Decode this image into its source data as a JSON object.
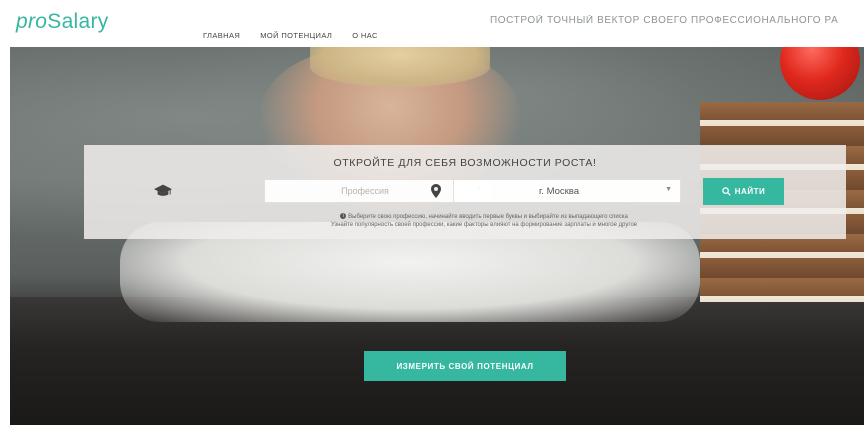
{
  "logo": {
    "part1": "pro",
    "part2": "Salary"
  },
  "nav": [
    {
      "label": "ГЛАВНАЯ"
    },
    {
      "label": "МОЙ ПОТЕНЦИАЛ"
    },
    {
      "label": "О НАС"
    }
  ],
  "tagline": "ПОСТРОЙ ТОЧНЫЙ ВЕКТОР СВОЕГО ПРОФЕССИОНАЛЬНОГО РА",
  "search": {
    "title": "ОТКРОЙТЕ ДЛЯ СЕБЯ ВОЗМОЖНОСТИ РОСТА!",
    "profession_placeholder": "Профессия",
    "city_value": "г. Москва",
    "find_label": "НАЙТИ",
    "hint_line1": "Выберите свою профессию, начинайте вводить первые буквы и выбирайте из выпадающего списка",
    "hint_line2": "Узнайте популярность своей профессии, какие факторы влияют на формирование зарплаты и многое другое"
  },
  "cta": {
    "label": "ИЗМЕРИТЬ СВОЙ ПОТЕНЦИАЛ"
  },
  "icons": [
    "graduation-cap-icon",
    "map-pin-icon",
    "search-icon",
    "info-icon",
    "caret-down-icon"
  ],
  "colors": {
    "accent": "#35b7a0",
    "text": "#444444",
    "tagline": "#8d9593"
  }
}
